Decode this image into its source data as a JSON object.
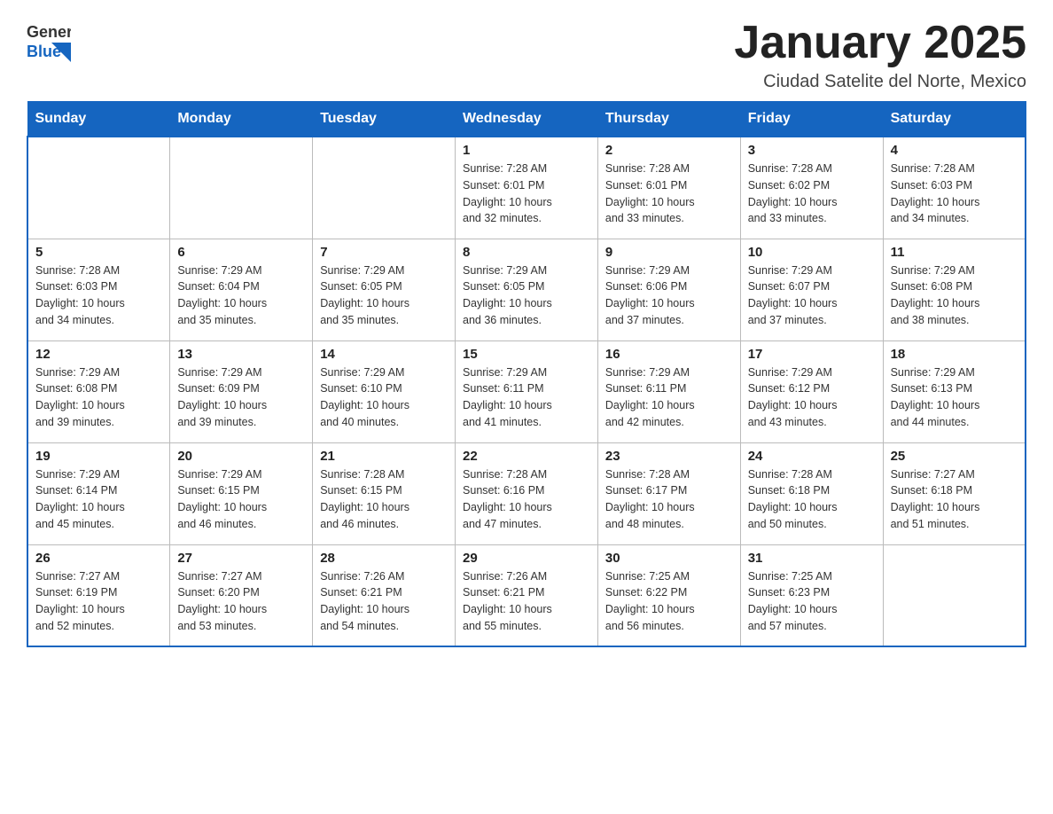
{
  "header": {
    "logo_general": "General",
    "logo_blue": "Blue",
    "title": "January 2025",
    "subtitle": "Ciudad Satelite del Norte, Mexico"
  },
  "days_of_week": [
    "Sunday",
    "Monday",
    "Tuesday",
    "Wednesday",
    "Thursday",
    "Friday",
    "Saturday"
  ],
  "weeks": [
    [
      {
        "day": "",
        "info": ""
      },
      {
        "day": "",
        "info": ""
      },
      {
        "day": "",
        "info": ""
      },
      {
        "day": "1",
        "info": "Sunrise: 7:28 AM\nSunset: 6:01 PM\nDaylight: 10 hours\nand 32 minutes."
      },
      {
        "day": "2",
        "info": "Sunrise: 7:28 AM\nSunset: 6:01 PM\nDaylight: 10 hours\nand 33 minutes."
      },
      {
        "day": "3",
        "info": "Sunrise: 7:28 AM\nSunset: 6:02 PM\nDaylight: 10 hours\nand 33 minutes."
      },
      {
        "day": "4",
        "info": "Sunrise: 7:28 AM\nSunset: 6:03 PM\nDaylight: 10 hours\nand 34 minutes."
      }
    ],
    [
      {
        "day": "5",
        "info": "Sunrise: 7:28 AM\nSunset: 6:03 PM\nDaylight: 10 hours\nand 34 minutes."
      },
      {
        "day": "6",
        "info": "Sunrise: 7:29 AM\nSunset: 6:04 PM\nDaylight: 10 hours\nand 35 minutes."
      },
      {
        "day": "7",
        "info": "Sunrise: 7:29 AM\nSunset: 6:05 PM\nDaylight: 10 hours\nand 35 minutes."
      },
      {
        "day": "8",
        "info": "Sunrise: 7:29 AM\nSunset: 6:05 PM\nDaylight: 10 hours\nand 36 minutes."
      },
      {
        "day": "9",
        "info": "Sunrise: 7:29 AM\nSunset: 6:06 PM\nDaylight: 10 hours\nand 37 minutes."
      },
      {
        "day": "10",
        "info": "Sunrise: 7:29 AM\nSunset: 6:07 PM\nDaylight: 10 hours\nand 37 minutes."
      },
      {
        "day": "11",
        "info": "Sunrise: 7:29 AM\nSunset: 6:08 PM\nDaylight: 10 hours\nand 38 minutes."
      }
    ],
    [
      {
        "day": "12",
        "info": "Sunrise: 7:29 AM\nSunset: 6:08 PM\nDaylight: 10 hours\nand 39 minutes."
      },
      {
        "day": "13",
        "info": "Sunrise: 7:29 AM\nSunset: 6:09 PM\nDaylight: 10 hours\nand 39 minutes."
      },
      {
        "day": "14",
        "info": "Sunrise: 7:29 AM\nSunset: 6:10 PM\nDaylight: 10 hours\nand 40 minutes."
      },
      {
        "day": "15",
        "info": "Sunrise: 7:29 AM\nSunset: 6:11 PM\nDaylight: 10 hours\nand 41 minutes."
      },
      {
        "day": "16",
        "info": "Sunrise: 7:29 AM\nSunset: 6:11 PM\nDaylight: 10 hours\nand 42 minutes."
      },
      {
        "day": "17",
        "info": "Sunrise: 7:29 AM\nSunset: 6:12 PM\nDaylight: 10 hours\nand 43 minutes."
      },
      {
        "day": "18",
        "info": "Sunrise: 7:29 AM\nSunset: 6:13 PM\nDaylight: 10 hours\nand 44 minutes."
      }
    ],
    [
      {
        "day": "19",
        "info": "Sunrise: 7:29 AM\nSunset: 6:14 PM\nDaylight: 10 hours\nand 45 minutes."
      },
      {
        "day": "20",
        "info": "Sunrise: 7:29 AM\nSunset: 6:15 PM\nDaylight: 10 hours\nand 46 minutes."
      },
      {
        "day": "21",
        "info": "Sunrise: 7:28 AM\nSunset: 6:15 PM\nDaylight: 10 hours\nand 46 minutes."
      },
      {
        "day": "22",
        "info": "Sunrise: 7:28 AM\nSunset: 6:16 PM\nDaylight: 10 hours\nand 47 minutes."
      },
      {
        "day": "23",
        "info": "Sunrise: 7:28 AM\nSunset: 6:17 PM\nDaylight: 10 hours\nand 48 minutes."
      },
      {
        "day": "24",
        "info": "Sunrise: 7:28 AM\nSunset: 6:18 PM\nDaylight: 10 hours\nand 50 minutes."
      },
      {
        "day": "25",
        "info": "Sunrise: 7:27 AM\nSunset: 6:18 PM\nDaylight: 10 hours\nand 51 minutes."
      }
    ],
    [
      {
        "day": "26",
        "info": "Sunrise: 7:27 AM\nSunset: 6:19 PM\nDaylight: 10 hours\nand 52 minutes."
      },
      {
        "day": "27",
        "info": "Sunrise: 7:27 AM\nSunset: 6:20 PM\nDaylight: 10 hours\nand 53 minutes."
      },
      {
        "day": "28",
        "info": "Sunrise: 7:26 AM\nSunset: 6:21 PM\nDaylight: 10 hours\nand 54 minutes."
      },
      {
        "day": "29",
        "info": "Sunrise: 7:26 AM\nSunset: 6:21 PM\nDaylight: 10 hours\nand 55 minutes."
      },
      {
        "day": "30",
        "info": "Sunrise: 7:25 AM\nSunset: 6:22 PM\nDaylight: 10 hours\nand 56 minutes."
      },
      {
        "day": "31",
        "info": "Sunrise: 7:25 AM\nSunset: 6:23 PM\nDaylight: 10 hours\nand 57 minutes."
      },
      {
        "day": "",
        "info": ""
      }
    ]
  ]
}
